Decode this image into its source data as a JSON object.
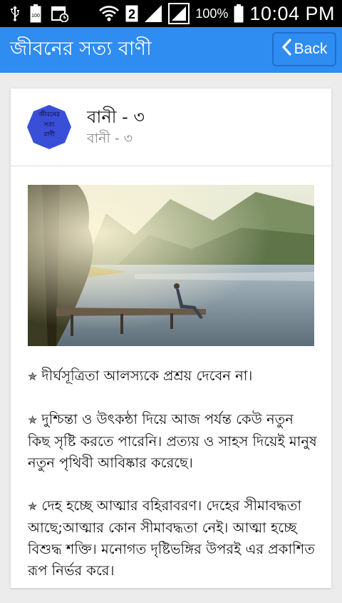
{
  "status_bar": {
    "battery_left": "100",
    "sim_slot": "2",
    "battery_percent": "100%",
    "time": "10:04 PM",
    "icons": [
      "usb-icon",
      "battery-icon",
      "calendar-icon",
      "wifi-icon",
      "sim-icon",
      "signal-icon",
      "signal-icon",
      "battery-icon"
    ]
  },
  "app_bar": {
    "title": "জীবনের সত্য বাণী",
    "back_label": "Back",
    "color": "#2f8cf0"
  },
  "card": {
    "badge_lines": [
      "জীবনের",
      "সত্য",
      "বাণী"
    ],
    "badge_color": "#3a4fd8",
    "title": "বানী - ৩",
    "subtitle": "বানী - ৩",
    "paragraphs": [
      "দীর্ঘসূত্রিতা আলস্যকে প্রশ্রয় দেবেন না।",
      "দুশ্চিন্তা ও উৎকন্ঠা দিয়ে আজ পর্যন্ত কেউ নতুন কিছ সৃষ্টি করতে পারেনি। প্রত্যয় ও সাহস দিয়েই মানুষ নতুন পৃথিবী আবিষ্কার করেছে।",
      "দেহ হচ্ছে আত্মার বহিরাবরণ। দেহের সীমাবদ্ধতা আছে;আত্মার কোন সীমাবদ্ধতা নেই। আত্মা হচ্ছে বিশুদ্ধ শক্তি। মনোগত দৃষ্টিভঙ্গির উপরই এর প্রকাশিত রূপ নির্ভর করে।"
    ]
  }
}
